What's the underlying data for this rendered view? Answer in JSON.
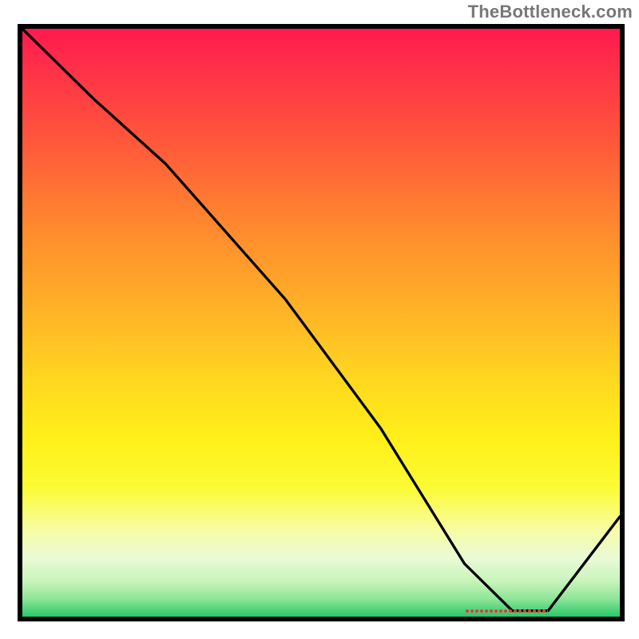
{
  "watermark": "TheBottleneck.com",
  "chart_data": {
    "type": "line",
    "title": "",
    "xlabel": "",
    "ylabel": "",
    "xlim": [
      0,
      100
    ],
    "ylim": [
      0,
      100
    ],
    "gradient_stops": [
      {
        "pos": 0,
        "color": "#ff1a4e"
      },
      {
        "pos": 8,
        "color": "#ff3447"
      },
      {
        "pos": 20,
        "color": "#ff5a3a"
      },
      {
        "pos": 34,
        "color": "#ff8a2e"
      },
      {
        "pos": 48,
        "color": "#ffb327"
      },
      {
        "pos": 60,
        "color": "#ffd81f"
      },
      {
        "pos": 70,
        "color": "#fff01a"
      },
      {
        "pos": 78,
        "color": "#fbfb33"
      },
      {
        "pos": 85,
        "color": "#f8fca0"
      },
      {
        "pos": 90,
        "color": "#eafad6"
      },
      {
        "pos": 94,
        "color": "#c8f4bb"
      },
      {
        "pos": 97,
        "color": "#8de597"
      },
      {
        "pos": 100,
        "color": "#28c86b"
      }
    ],
    "series": [
      {
        "name": "bottleneck-curve",
        "x": [
          0,
          12,
          24,
          44,
          60,
          74,
          82,
          88,
          100
        ],
        "y": [
          100,
          88,
          77,
          54,
          32,
          9,
          1,
          1,
          17
        ]
      }
    ],
    "marker": {
      "x_start": 74,
      "x_end": 88,
      "y": 1,
      "color": "#e83b3b"
    }
  }
}
